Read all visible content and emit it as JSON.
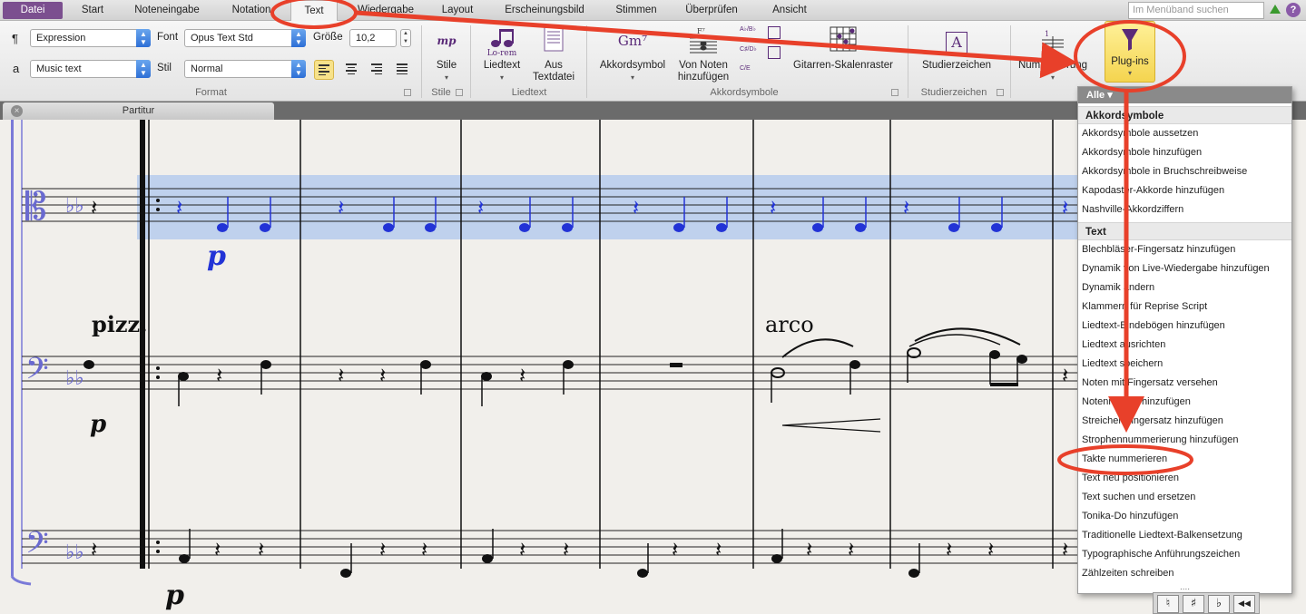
{
  "tabs": [
    {
      "label": "Datei"
    },
    {
      "label": "Start"
    },
    {
      "label": "Noteneingabe"
    },
    {
      "label": "Notation"
    },
    {
      "label": "Text"
    },
    {
      "label": "Wiedergabe"
    },
    {
      "label": "Layout"
    },
    {
      "label": "Erscheinungsbild"
    },
    {
      "label": "Stimmen"
    },
    {
      "label": "Überprüfen"
    },
    {
      "label": "Ansicht"
    }
  ],
  "search": {
    "placeholder": "Im Menüband suchen"
  },
  "help": {
    "label": "?"
  },
  "format": {
    "para_glyph": "¶",
    "char_glyph": "a",
    "style_select_1": "Expression",
    "style_select_2": "Music text",
    "font_label": "Font",
    "font_value": "Opus Text Std",
    "style_label": "Stil",
    "style_value": "Normal",
    "size_label": "Größe",
    "size_value": "10,2",
    "group_label": "Format"
  },
  "styles": {
    "icon_text": "mp",
    "button_label": "Stile",
    "group_label": "Stile"
  },
  "lyrics": {
    "icon_text": "Lo-rem",
    "lyrics_label": "Liedtext",
    "from_file_line1": "Aus",
    "from_file_line2": "Textdatei",
    "group_label": "Liedtext"
  },
  "chords": {
    "icon_text": "Gm⁷",
    "chord_symbol_label": "Akkordsymbol",
    "from_notes_line1": "Von Noten",
    "from_notes_line2": "hinzufügen",
    "small_icon_1": "A♭/B♭",
    "small_icon_2": "C♯/D♭",
    "small_icon_3": "C/E",
    "small_icon_4": "F⁷",
    "guitar_scale_label": "Gitarren-Skalenraster",
    "group_label": "Akkordsymbole"
  },
  "rehearsal": {
    "icon_text": "A",
    "button_label": "Studierzeichen",
    "group_label": "Studierzeichen"
  },
  "numbering": {
    "button_label": "Nummerierung"
  },
  "plugins": {
    "button_label": "Plug-ins"
  },
  "score_tab": {
    "label": "Partitur",
    "close_glyph": "×"
  },
  "score_text": {
    "pizz": "pizz.",
    "arco": "arco",
    "dyn_p_1": "p",
    "dyn_p_2": "p",
    "dyn_partial": "p"
  },
  "menu": {
    "filter_label": "Alle ▾",
    "sections": [
      {
        "title": "Akkordsymbole",
        "items": [
          "Akkordsymbole aussetzen",
          "Akkordsymbole hinzufügen",
          "Akkordsymbole in Bruchschreibweise",
          "Kapodaster-Akkorde hinzufügen",
          "Nashville-Akkordziffern"
        ]
      },
      {
        "title": "Text",
        "items": [
          "Blechbläser-Fingersatz hinzufügen",
          "Dynamik von Live-Wiedergabe hinzufügen",
          "Dynamik ändern",
          "Klammern für Reprise Script",
          "Liedtext-Bindebögen hinzufügen",
          "Liedtext ausrichten",
          "Liedtext speichern",
          "Noten mit Fingersatz versehen",
          "Notennamen hinzufügen",
          "Streicher-Fingersatz hinzufügen",
          "Strophennummerierung hinzufügen",
          "Takte nummerieren",
          "Text neu positionieren",
          "Text suchen und ersetzen",
          "Tonika-Do hinzufügen",
          "Traditionelle Liedtext-Balkensetzung",
          "Typographische Anführungszeichen",
          "Zählzeiten schreiben"
        ]
      }
    ],
    "more": "....",
    "highlighted_item": "Takte nummerieren"
  },
  "keypad": {
    "keys": [
      "♮",
      "♯",
      "♭",
      "◀◀"
    ]
  },
  "colors": {
    "accent": "#7b4f8f",
    "annotation_red": "#e8402a",
    "selection_blue": "#a9c4ee",
    "note_blue": "#2233d6",
    "plugin_yellow": "#f4d44f"
  }
}
